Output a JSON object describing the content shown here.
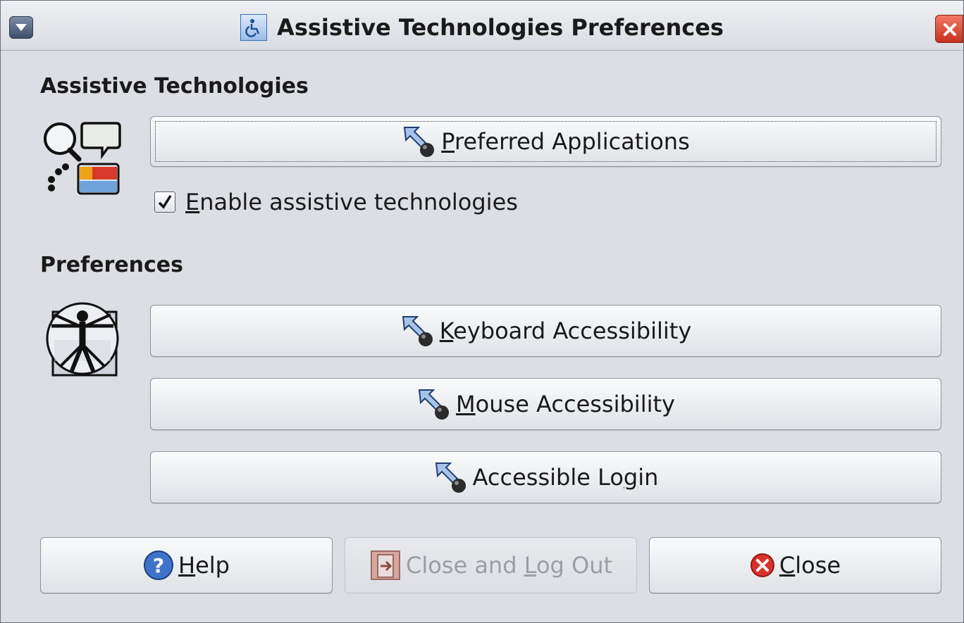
{
  "window": {
    "title": "Assistive Technologies Preferences"
  },
  "assistive": {
    "heading": "Assistive Technologies",
    "preferred_apps": {
      "pre": "",
      "underline": "P",
      "post": "referred Applications"
    },
    "enable_checkbox": {
      "checked": true,
      "underline": "E",
      "post": "nable assistive technologies"
    }
  },
  "preferences": {
    "heading": "Preferences",
    "keyboard": {
      "pre": "",
      "underline": "K",
      "post": "eyboard Accessibility"
    },
    "mouse": {
      "pre": "",
      "underline": "M",
      "post": "ouse Accessibility"
    },
    "login": {
      "pre": "Accessible Lo",
      "underline": "g",
      "post": "in"
    }
  },
  "footer": {
    "help": {
      "pre": "",
      "underline": "H",
      "post": "elp"
    },
    "logout": {
      "pre": "Close and ",
      "underline": "L",
      "post": "og Out",
      "disabled": true
    },
    "close": {
      "pre": "",
      "underline": "C",
      "post": "lose"
    }
  },
  "icons": {
    "menu": "window-menu-icon",
    "app": "accessibility-wheelchair-icon",
    "close": "window-close-icon",
    "assistive_tech": "magnifier-speech-icon",
    "preferences": "vitruvian-man-icon",
    "launch": "launch-arrow-icon",
    "help": "help-icon",
    "logout": "logout-icon",
    "close_btn": "close-circle-icon"
  },
  "colors": {
    "accent_blue": "#3c6cb6",
    "close_red": "#c7311e",
    "window_bg": "#dcdee3"
  }
}
